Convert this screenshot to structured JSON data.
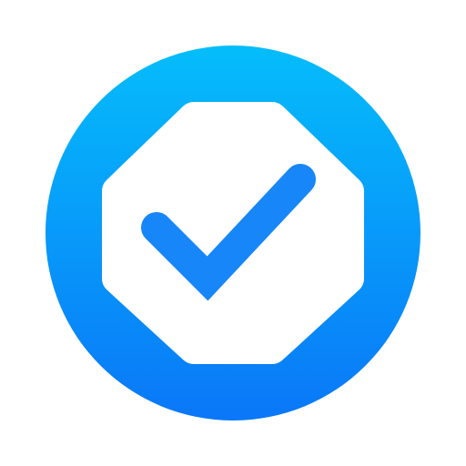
{
  "icon": {
    "name": "verified-checkmark-badge",
    "shapes": {
      "background": "circle",
      "badge": "octagon",
      "mark": "checkmark"
    },
    "colors": {
      "page_background": "#ffffff",
      "circle_gradient_top": "#05BDFB",
      "circle_gradient_bottom": "#0A77F8",
      "octagon_fill": "#ffffff",
      "checkmark_fill": "#1786F8"
    }
  }
}
